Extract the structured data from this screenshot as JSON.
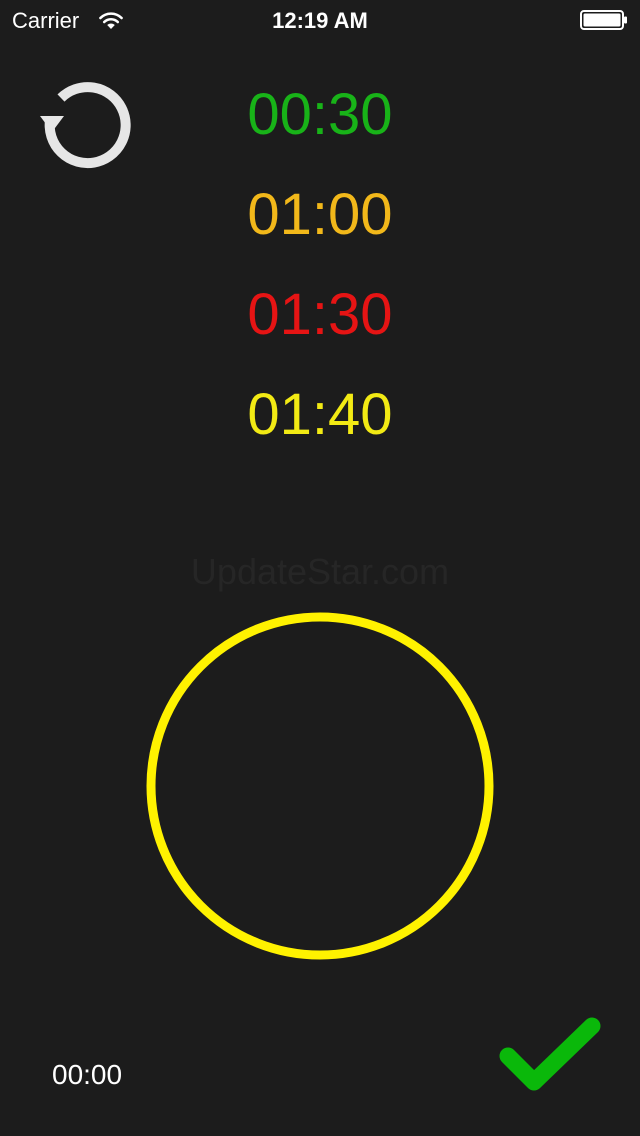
{
  "status_bar": {
    "carrier": "Carrier",
    "time": "12:19 AM",
    "wifi_icon": "wifi-icon",
    "battery_icon": "battery-icon"
  },
  "reset": {
    "icon": "reset-icon",
    "color": "#e6e6e6"
  },
  "intervals": [
    {
      "time": "00:30",
      "color": "#18b318"
    },
    {
      "time": "01:00",
      "color": "#f2b81a"
    },
    {
      "time": "01:30",
      "color": "#e61414"
    },
    {
      "time": "01:40",
      "color": "#f2ea14"
    }
  ],
  "watermark": "UpdateStar.com",
  "circle": {
    "color": "#fff200"
  },
  "elapsed": "00:00",
  "done": {
    "icon": "checkmark-icon",
    "color": "#0ab80a"
  }
}
